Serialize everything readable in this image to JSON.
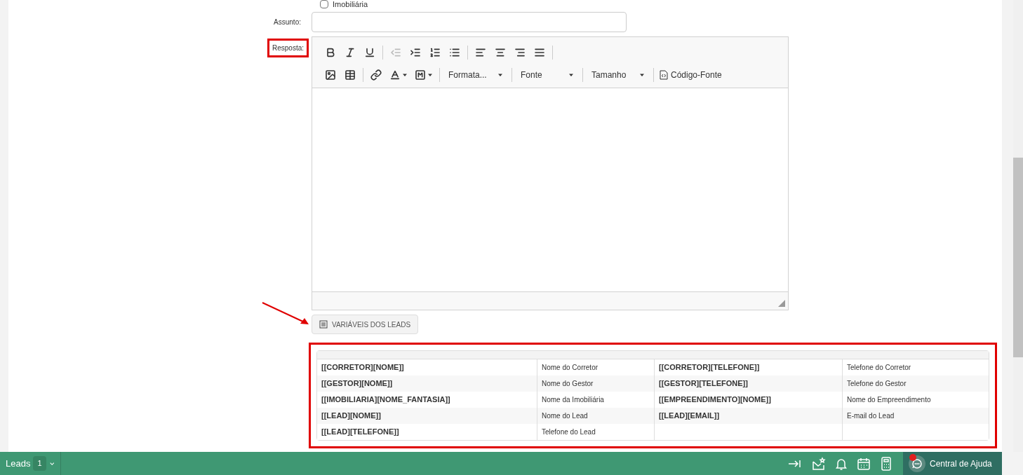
{
  "top_checkbox": {
    "label": "Imobiliária",
    "checked": false
  },
  "assunto": {
    "label": "Assunto:"
  },
  "resposta": {
    "label": "Resposta:",
    "highlighted": true
  },
  "editor": {
    "row1": [
      {
        "kind": "bold",
        "disabled": false
      },
      {
        "kind": "italic",
        "disabled": false
      },
      {
        "kind": "underline",
        "disabled": false
      },
      {
        "kind": "sep"
      },
      {
        "kind": "outdent",
        "disabled": true
      },
      {
        "kind": "indent",
        "disabled": false
      },
      {
        "kind": "ol",
        "disabled": false
      },
      {
        "kind": "ul",
        "disabled": false
      },
      {
        "kind": "sep"
      },
      {
        "kind": "left",
        "disabled": false
      },
      {
        "kind": "center",
        "disabled": false
      },
      {
        "kind": "right",
        "disabled": false
      },
      {
        "kind": "justify",
        "disabled": false
      },
      {
        "kind": "sep"
      }
    ],
    "row2": [
      {
        "kind": "image",
        "disabled": false
      },
      {
        "kind": "table",
        "disabled": false
      },
      {
        "kind": "sep"
      },
      {
        "kind": "link",
        "disabled": false
      },
      {
        "kind": "textcolor",
        "disabled": false
      },
      {
        "kind": "bgcolor",
        "disabled": false
      }
    ],
    "dropdowns": [
      "Formata...",
      "Fonte",
      "Tamanho"
    ],
    "source_label": "Código-Fonte"
  },
  "variables_button": "VARIÁVEIS DOS LEADS",
  "variables_table": {
    "highlighted": true,
    "rows": [
      [
        "[[CORRETOR][NOME]]",
        "Nome do Corretor",
        "[[CORRETOR][TELEFONE]]",
        "Telefone do Corretor"
      ],
      [
        "[[GESTOR][NOME]]",
        "Nome do Gestor",
        "[[GESTOR][TELEFONE]]",
        "Telefone do Gestor"
      ],
      [
        "[[IMOBILIARIA][NOME_FANTASIA]]",
        "Nome da Imobiliária",
        "[[EMPREENDIMENTO][NOME]]",
        "Nome do Empreendimento"
      ],
      [
        "[[LEAD][NOME]]",
        "Nome do Lead",
        "[[LEAD][EMAIL]]",
        "E-mail do Lead"
      ],
      [
        "[[LEAD][TELEFONE]]",
        "Telefone do Lead",
        "",
        ""
      ]
    ]
  },
  "bottom_bar": {
    "leads_label": "Leads",
    "leads_count": "1",
    "help_label": "Central de Ajuda",
    "help_notification": true
  }
}
